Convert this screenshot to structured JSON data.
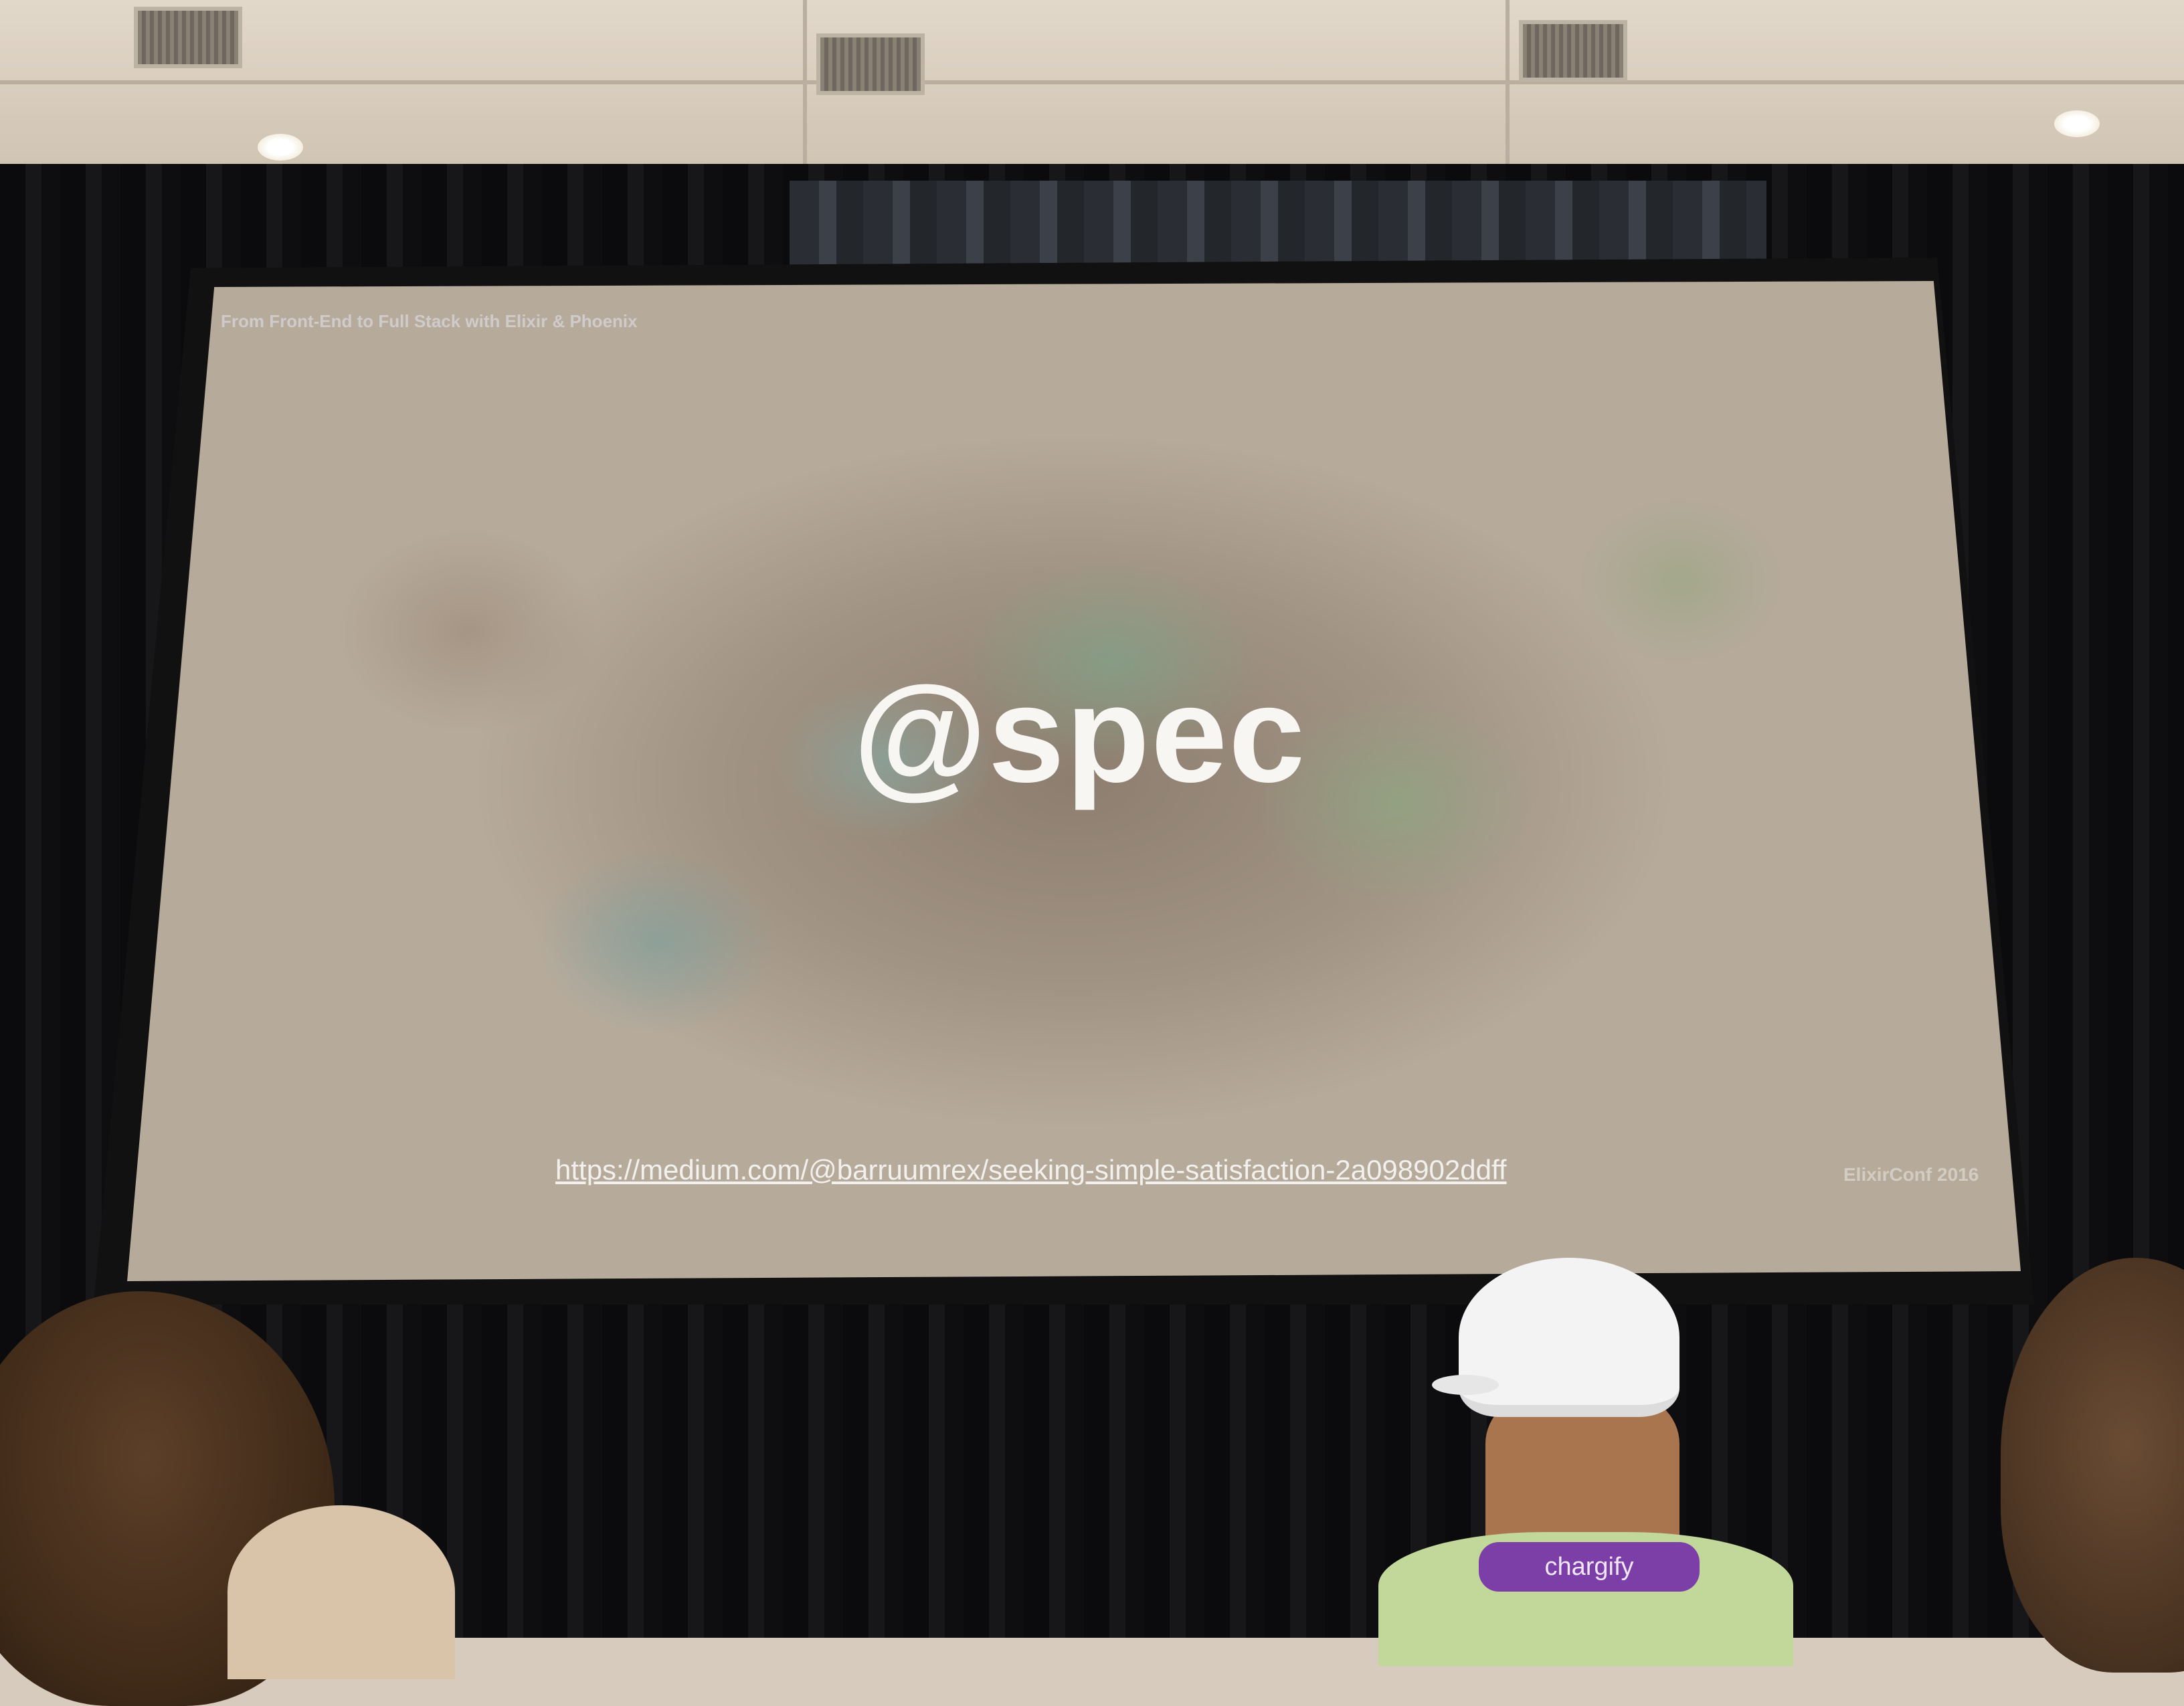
{
  "slide": {
    "header": "From Front-End to Full Stack with Elixir & Phoenix",
    "title": "@spec",
    "link": "https://medium.com/@barruumrex/seeking-simple-satisfaction-2a098902ddff",
    "footer": "ElixirConf 2016"
  },
  "audience": {
    "lanyard_text": "chargify"
  },
  "colors": {
    "curtain": "#111113",
    "ceiling": "#d9cfc0",
    "slide_background": "#9c8e7e",
    "slide_text": "#f7f6f3",
    "lanyard": "#7c3fa8"
  }
}
